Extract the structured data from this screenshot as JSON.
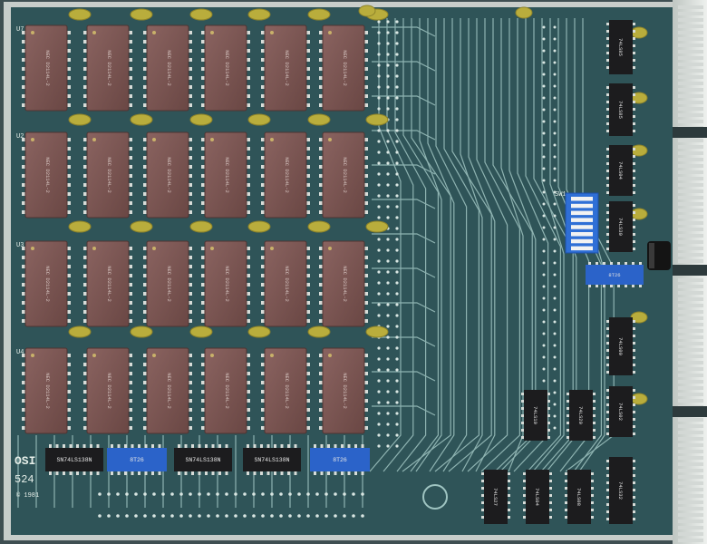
{
  "board": {
    "brand_label": "OSI",
    "model_label": "524",
    "copyright_label": "© 1981",
    "row_labels": [
      "U7",
      "U2",
      "U3",
      "U4"
    ],
    "dip_switch_label": "SW1",
    "colors": {
      "pcb": "#2f5458",
      "pcb_dark": "#233f42",
      "trace": "#9fc4c1",
      "silkscreen": "#e6efe9",
      "ram_chip": "#7d5753",
      "logic_chip": "#1c1c1e",
      "blue_chip": "#2b63c9",
      "capacitor": "#b9ad3c",
      "edge_connector": "#d7dcd8",
      "frame": "#c8cdca"
    }
  },
  "ram_chips": [
    {
      "id": "U7-1",
      "marking": "NEC D2114L-2"
    },
    {
      "id": "U7-2",
      "marking": "NEC D2114L-2"
    },
    {
      "id": "U7-3",
      "marking": "NEC D2114L-2"
    },
    {
      "id": "U7-4",
      "marking": "NEC D2114L-2"
    },
    {
      "id": "U7-5",
      "marking": "NEC D2114L-2"
    },
    {
      "id": "U7-6",
      "marking": "NEC D2114L-2"
    },
    {
      "id": "U2-1",
      "marking": "NEC D2114L-2"
    },
    {
      "id": "U2-2",
      "marking": "NEC D2114L-2"
    },
    {
      "id": "U2-3",
      "marking": "NEC D2114L-2"
    },
    {
      "id": "U2-4",
      "marking": "NEC D2114L-2"
    },
    {
      "id": "U2-5",
      "marking": "NEC D2114L-2"
    },
    {
      "id": "U2-6",
      "marking": "NEC D2114L-2"
    },
    {
      "id": "U3-1",
      "marking": "NEC D2114L-2"
    },
    {
      "id": "U3-2",
      "marking": "NEC D2114L-2"
    },
    {
      "id": "U3-3",
      "marking": "NEC D2114L-2"
    },
    {
      "id": "U3-4",
      "marking": "NEC D2114L-2"
    },
    {
      "id": "U3-5",
      "marking": "NEC D2114L-2"
    },
    {
      "id": "U3-6",
      "marking": "NEC D2114L-2"
    },
    {
      "id": "U4-1",
      "marking": "NEC D2114L-2"
    },
    {
      "id": "U4-2",
      "marking": "NEC D2114L-2"
    },
    {
      "id": "U4-3",
      "marking": "NEC D2114L-2"
    },
    {
      "id": "U4-4",
      "marking": "NEC D2114L-2"
    },
    {
      "id": "U4-5",
      "marking": "NEC D2114L-2"
    },
    {
      "id": "U4-6",
      "marking": "NEC D2114L-2"
    }
  ],
  "bottom_chips": [
    {
      "type": "logic",
      "marking": "SN74LS138N"
    },
    {
      "type": "blue",
      "marking": "8T26"
    },
    {
      "type": "logic",
      "marking": "SN74LS138N"
    },
    {
      "type": "logic",
      "marking": "SN74LS138N"
    },
    {
      "type": "blue",
      "marking": "8T26"
    }
  ],
  "right_chips": [
    {
      "type": "logic",
      "marking": "74LS85"
    },
    {
      "type": "logic",
      "marking": "74LS85"
    },
    {
      "type": "logic",
      "marking": "74LS04"
    },
    {
      "type": "logic",
      "marking": "74LS30"
    },
    {
      "type": "blue",
      "marking": "8T26"
    },
    {
      "type": "logic",
      "marking": "74LS00"
    },
    {
      "type": "logic",
      "marking": "74LS02"
    },
    {
      "type": "logic",
      "marking": "74LS32"
    },
    {
      "type": "logic",
      "marking": "74LS10"
    },
    {
      "type": "logic",
      "marking": "74LS20"
    },
    {
      "type": "logic",
      "marking": "74LS27"
    },
    {
      "type": "logic",
      "marking": "74LS04"
    },
    {
      "type": "logic",
      "marking": "74LS08"
    }
  ]
}
